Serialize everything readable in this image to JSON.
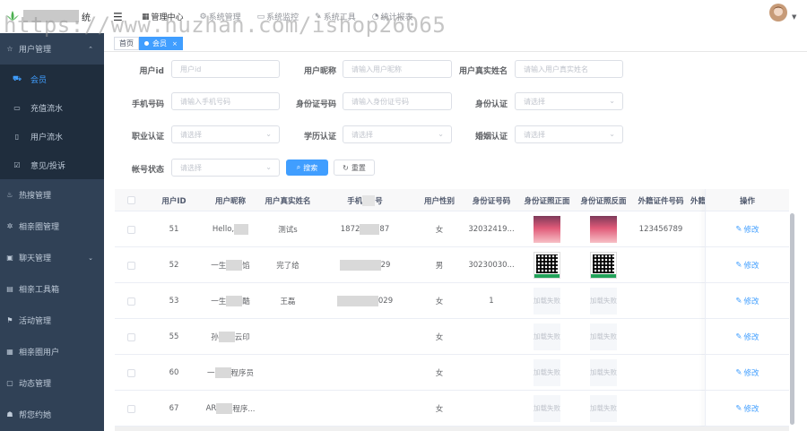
{
  "header": {
    "brand_suffix": "统",
    "nav": [
      {
        "icon": "grid-icon",
        "glyph": "▦",
        "label": "管理中心",
        "active": true
      },
      {
        "icon": "gear-icon",
        "glyph": "⚙",
        "label": "系统管理",
        "active": false
      },
      {
        "icon": "monitor-icon",
        "glyph": "▭",
        "label": "系统监控",
        "active": false
      },
      {
        "icon": "tool-icon",
        "glyph": "✎",
        "label": "系统工具",
        "active": false
      },
      {
        "icon": "chart-icon",
        "glyph": "◔",
        "label": "统计报表",
        "active": false
      }
    ],
    "watermark": "https://www.huzhan.com/ishop26065"
  },
  "sidebar": {
    "groups": [
      {
        "label": "用户管理",
        "icon": "star-icon",
        "glyph": "☆",
        "chevron": "⌃",
        "children": [
          {
            "label": "会员",
            "icon": "car-icon",
            "glyph": "⛟",
            "active": true
          },
          {
            "label": "充值流水",
            "icon": "card-icon",
            "glyph": "▭",
            "active": false
          },
          {
            "label": "用户流水",
            "icon": "book-icon",
            "glyph": "▯",
            "active": false
          },
          {
            "label": "意见/投诉",
            "icon": "checkbox-icon",
            "glyph": "☑",
            "active": false
          }
        ]
      },
      {
        "label": "热搜管理",
        "icon": "fire-icon",
        "glyph": "♨"
      },
      {
        "label": "相亲圈管理",
        "icon": "sun-icon",
        "glyph": "✲"
      },
      {
        "label": "聊天管理",
        "icon": "chat-icon",
        "glyph": "▣",
        "chevron": "⌄"
      },
      {
        "label": "相亲工具箱",
        "icon": "toolbox-icon",
        "glyph": "▤"
      },
      {
        "label": "活动管理",
        "icon": "flag-icon",
        "glyph": "⚑"
      },
      {
        "label": "相亲圈用户",
        "icon": "list-icon",
        "glyph": "▦"
      },
      {
        "label": "动态管理",
        "icon": "form-icon",
        "glyph": "▢"
      },
      {
        "label": "帮您约她",
        "icon": "user-icon",
        "glyph": "☗"
      }
    ]
  },
  "tags": {
    "home": "首页",
    "current": "会员",
    "close": "×"
  },
  "filters": {
    "user_id": {
      "label": "用户id",
      "placeholder": "用户id"
    },
    "nickname": {
      "label": "用户昵称",
      "placeholder": "请输入用户昵称"
    },
    "realname": {
      "label": "用户真实姓名",
      "placeholder": "请输入用户真实姓名"
    },
    "phone": {
      "label": "手机号码",
      "placeholder": "请输入手机号码"
    },
    "idcard": {
      "label": "身份证号码",
      "placeholder": "请输入身份证号码"
    },
    "id_auth": {
      "label": "身份认证",
      "placeholder": "请选择"
    },
    "job_auth": {
      "label": "职业认证",
      "placeholder": "请选择"
    },
    "edu_auth": {
      "label": "学历认证",
      "placeholder": "请选择"
    },
    "marry_auth": {
      "label": "婚姻认证",
      "placeholder": "请选择"
    },
    "account_status": {
      "label": "帐号状态",
      "placeholder": "请选择"
    },
    "search_btn": "搜索",
    "reset_btn": "重置"
  },
  "table": {
    "headers": {
      "id": "用户ID",
      "nickname": "用户昵称",
      "realname": "用户真实姓名",
      "phone_a": "手机",
      "phone_b": "号",
      "gender": "用户性别",
      "idcard": "身份证号码",
      "front": "身份证照正面",
      "back": "身份证照反面",
      "foreign": "外籍证件号码",
      "foreign2": "外籍",
      "op": "操作"
    },
    "edit_label": "修改",
    "fail_text": "加载失败",
    "rows": [
      {
        "id": "51",
        "nick": "Hello,",
        "real": "测试s",
        "phone_a": "1872",
        "phone_b": "87",
        "gender": "女",
        "idcard": "32032419...",
        "front": "pink",
        "back": "pink",
        "foreign": "123456789"
      },
      {
        "id": "52",
        "nick": "一生",
        "nick_b": "馅",
        "real": "完了给",
        "phone_a": "",
        "phone_b": "29",
        "gender": "男",
        "idcard": "30230030...",
        "front": "qr",
        "back": "qr",
        "foreign": ""
      },
      {
        "id": "53",
        "nick": "一生",
        "nick_b": "酷",
        "real": "王磊",
        "phone_a": "",
        "phone_b": "029",
        "gender": "女",
        "idcard": "1",
        "front": "fail",
        "back": "fail",
        "foreign": ""
      },
      {
        "id": "55",
        "nick": "孙",
        "nick_b": "云印",
        "real": "",
        "phone_a": "",
        "phone_b": "",
        "gender": "女",
        "idcard": "",
        "front": "fail",
        "back": "fail",
        "foreign": ""
      },
      {
        "id": "60",
        "nick": "一",
        "nick_b": "程序员",
        "real": "",
        "phone_a": "",
        "phone_b": "",
        "gender": "女",
        "idcard": "",
        "front": "fail",
        "back": "fail",
        "foreign": ""
      },
      {
        "id": "67",
        "nick": "AR",
        "nick_b": "程序...",
        "real": "",
        "phone_a": "",
        "phone_b": "",
        "gender": "女",
        "idcard": "",
        "front": "fail",
        "back": "fail",
        "foreign": ""
      }
    ]
  },
  "colors": {
    "primary": "#409eff",
    "sidebar": "#304156",
    "sidebar_sub": "#1f2d3d"
  }
}
